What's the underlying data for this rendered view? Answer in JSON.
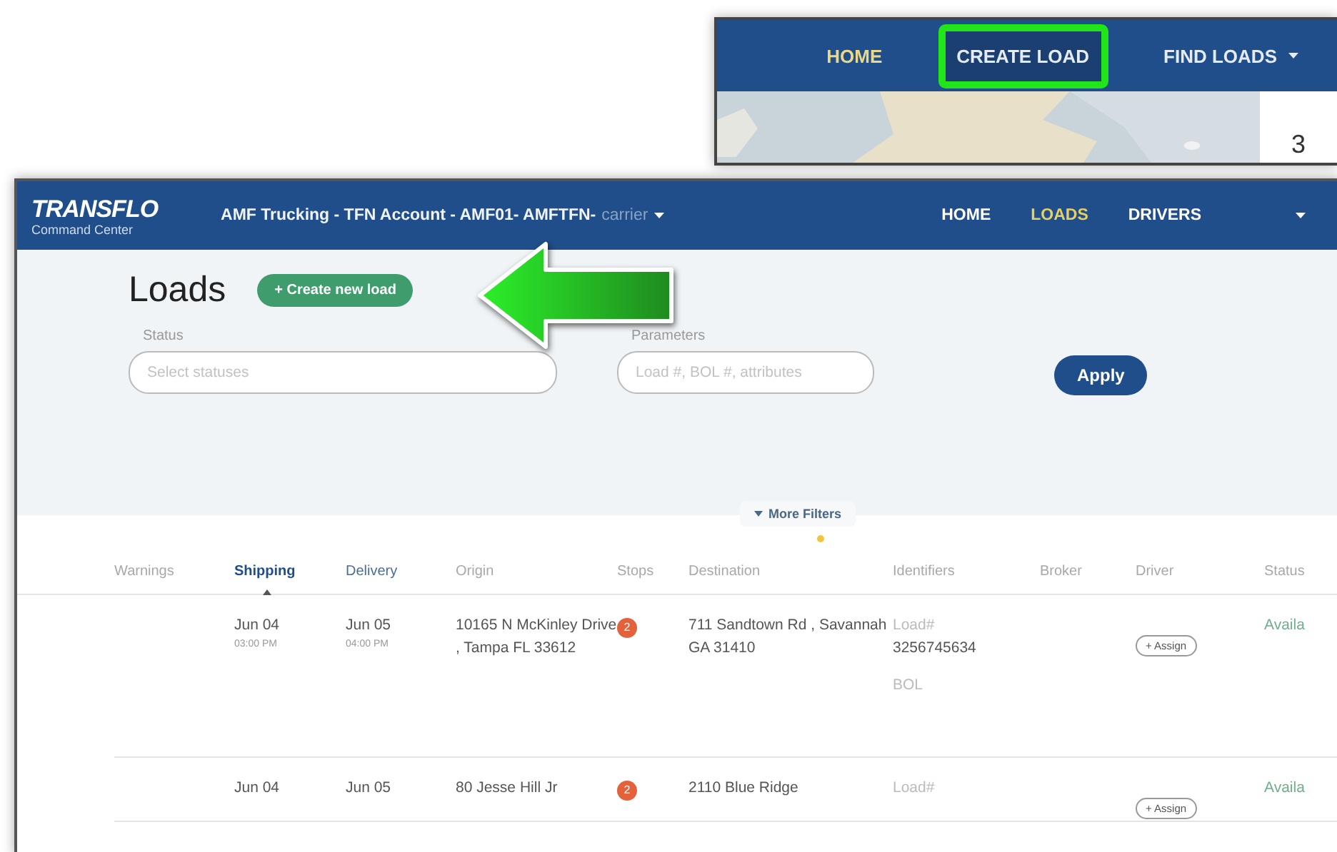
{
  "inset": {
    "nav": [
      {
        "label": "HOME",
        "selected": true,
        "highlighted": false,
        "dropdown": false
      },
      {
        "label": "CREATE LOAD",
        "selected": false,
        "highlighted": true,
        "dropdown": false
      },
      {
        "label": "FIND LOADS",
        "selected": false,
        "highlighted": false,
        "dropdown": true
      }
    ],
    "count": "3"
  },
  "window": {
    "brand": {
      "name": "TRANSFLO",
      "subtitle": "Command Center"
    },
    "account": {
      "name": "AMF Trucking - TFN Account - AMF01- AMFTFN-",
      "role": "carrier"
    },
    "nav": [
      {
        "label": "HOME",
        "selected": false
      },
      {
        "label": "LOADS",
        "selected": true
      },
      {
        "label": "DRIVERS",
        "selected": false
      }
    ],
    "page_title": "Loads",
    "create_button": "+ Create new load",
    "filters": [
      {
        "label": "Status",
        "placeholder": "Select statuses"
      },
      {
        "label": "Parameters",
        "placeholder": "Load #, BOL #, attributes"
      }
    ],
    "apply_button": "Apply",
    "more_filters": "More Filters",
    "table": {
      "columns": [
        {
          "label": "Warnings",
          "sortable": false,
          "selected": false
        },
        {
          "label": "Shipping",
          "sortable": true,
          "selected": true
        },
        {
          "label": "Delivery",
          "sortable": true,
          "selected": false
        },
        {
          "label": "Origin",
          "sortable": false,
          "selected": false
        },
        {
          "label": "Stops",
          "sortable": false,
          "selected": false
        },
        {
          "label": "Destination",
          "sortable": false,
          "selected": false
        },
        {
          "label": "Identifiers",
          "sortable": false,
          "selected": false
        },
        {
          "label": "Broker",
          "sortable": false,
          "selected": false
        },
        {
          "label": "Driver",
          "sortable": false,
          "selected": false
        },
        {
          "label": "Status",
          "sortable": false,
          "selected": false
        }
      ],
      "rows": [
        {
          "shipping": {
            "date": "Jun 04",
            "time": "03:00 PM"
          },
          "delivery": {
            "date": "Jun 05",
            "time": "04:00 PM"
          },
          "origin": "10165 N McKinley Drive , Tampa FL 33612",
          "stops": "2",
          "destination": "711 Sandtown Rd , Savannah GA 31410",
          "identifiers": [
            {
              "label": "Load#",
              "value": "3256745634"
            },
            {
              "label": "BOL"
            }
          ],
          "driver": "+ Assign",
          "status": "Availa"
        },
        {
          "shipping": {
            "date": "Jun 04"
          },
          "delivery": {
            "date": "Jun 05"
          },
          "origin": "80 Jesse Hill Jr",
          "stops": "2",
          "destination": "2110 Blue Ridge",
          "identifiers": [
            {
              "label": "Load#"
            }
          ],
          "driver": "+ Assign",
          "status": "Availa"
        }
      ]
    }
  }
}
